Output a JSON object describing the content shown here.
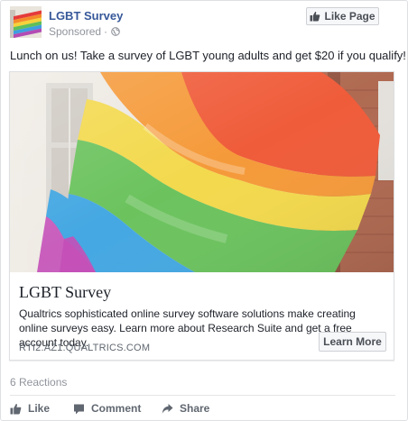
{
  "post": {
    "page_name": "LGBT Survey",
    "sponsored_label": "Sponsored",
    "separator": "·",
    "like_page_label": "Like Page",
    "text": "Lunch on us! Take a survey of LGBT young adults and get $20 if you qualify!"
  },
  "link_preview": {
    "title": "LGBT Survey",
    "description": "Qualtrics sophisticated online survey software solutions make creating online surveys easy. Learn more about Research Suite and get a free account today.",
    "domain": "RTI2.AZ1.QUALTRICS.COM",
    "cta_label": "Learn More"
  },
  "engagement": {
    "reactions_text": "6 Reactions"
  },
  "actions": [
    {
      "label": "Like",
      "icon": "thumbs-up-icon"
    },
    {
      "label": "Comment",
      "icon": "comment-icon"
    },
    {
      "label": "Share",
      "icon": "share-arrow-icon"
    }
  ],
  "colors": {
    "link_blue": "#365899",
    "muted": "#90949c",
    "action_text": "#606770",
    "border": "#dddfe2",
    "flag_stripes": [
      "#e53b3b",
      "#f58a2a",
      "#f6d23a",
      "#5fbf5a",
      "#3e9ee0",
      "#b24bb4"
    ]
  }
}
